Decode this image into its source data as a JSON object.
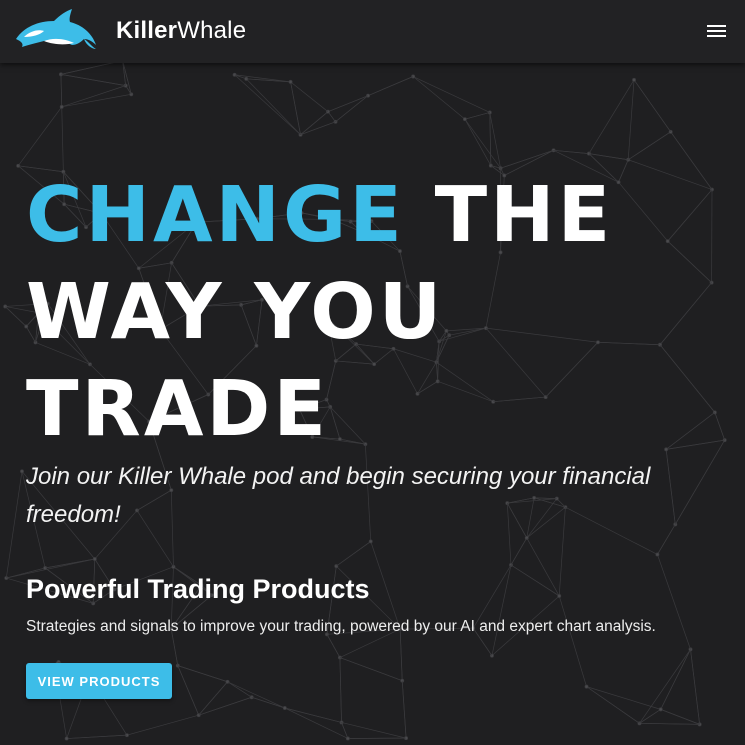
{
  "navbar": {
    "logo_icon": "orca-icon",
    "brand_bold": "Killer",
    "brand_light": "Whale",
    "menu_icon": "hamburger-icon"
  },
  "hero": {
    "headline_accent": "CHANGE",
    "headline_line1_rest": " THE",
    "headline_line2": "WAY YOU",
    "headline_line3": "TRADE",
    "tagline": "Join our Killer Whale pod and begin securing your financial freedom!"
  },
  "products": {
    "title": "Powerful Trading Products",
    "description": "Strategies and signals to improve your trading, powered by our AI and expert chart analysis.",
    "button_label": "VIEW PRODUCTS"
  },
  "colors": {
    "accent": "#3dbde8",
    "background": "#1f1f21",
    "navbar": "#222224",
    "text": "#ffffff"
  }
}
